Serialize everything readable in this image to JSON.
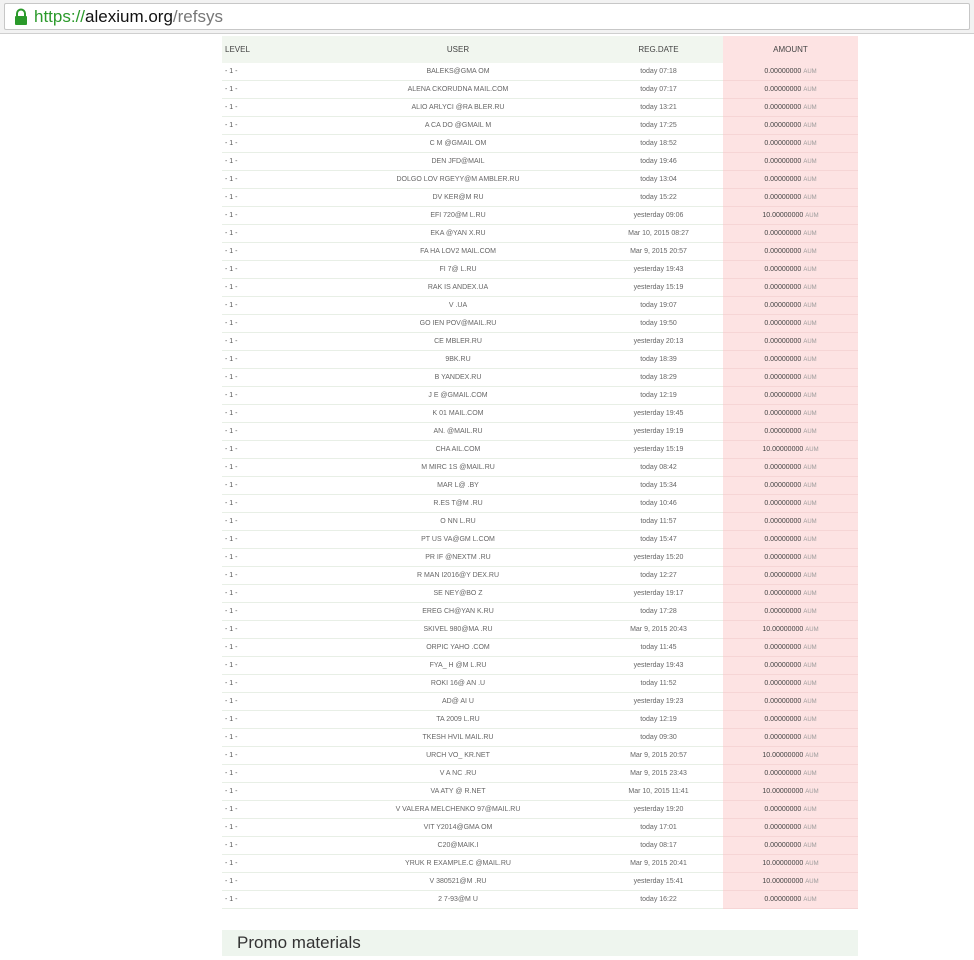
{
  "browser": {
    "url_scheme": "https://",
    "url_host": "alexium.org",
    "url_path": "/refsys"
  },
  "table": {
    "headers": {
      "level": "LEVEL",
      "user": "USER",
      "date": "REG.DATE",
      "amount": "AMOUNT"
    },
    "unit": "AUM",
    "rows": [
      {
        "level": "- 1 -",
        "user": "BALEKS@GMA    OM",
        "date": "today 07:18",
        "amount": "0.00000000"
      },
      {
        "level": "- 1 -",
        "user": "ALENA   CKORUDNA     MAIL.COM",
        "date": "today 07:17",
        "amount": "0.00000000"
      },
      {
        "level": "- 1 -",
        "user": "ALIO    ARLYCI    @RA    BLER.RU",
        "date": "today 13:21",
        "amount": "0.00000000"
      },
      {
        "level": "- 1 -",
        "user": "A     CA    DO    @GMAIL    M",
        "date": "today 17:25",
        "amount": "0.00000000"
      },
      {
        "level": "- 1 -",
        "user": "C    M     @GMAIL     OM",
        "date": "today 18:52",
        "amount": "0.00000000"
      },
      {
        "level": "- 1 -",
        "user": "DEN    JFD@MAIL",
        "date": "today 19:46",
        "amount": "0.00000000"
      },
      {
        "level": "- 1 -",
        "user": "DOLGO    LOV    RGEYY@M    AMBLER.RU",
        "date": "today 13:04",
        "amount": "0.00000000"
      },
      {
        "level": "- 1 -",
        "user": "DV    KER@M     RU",
        "date": "today 15:22",
        "amount": "0.00000000"
      },
      {
        "level": "- 1 -",
        "user": "EFI    720@M     L.RU",
        "date": "yesterday 09:06",
        "amount": "10.00000000"
      },
      {
        "level": "- 1 -",
        "user": "EKA    @YAN     X.RU",
        "date": "Mar 10, 2015 08:27",
        "amount": "0.00000000"
      },
      {
        "level": "- 1 -",
        "user": "FA    HA    LOV2    MAIL.COM",
        "date": "Mar 9, 2015 20:57",
        "amount": "0.00000000"
      },
      {
        "level": "- 1 -",
        "user": "FI     7@     L.RU",
        "date": "yesterday 19:43",
        "amount": "0.00000000"
      },
      {
        "level": "- 1 -",
        "user": "RAK    IS    ANDEX.UA",
        "date": "yesterday 15:19",
        "amount": "0.00000000"
      },
      {
        "level": "- 1 -",
        "user": "V     .UA",
        "date": "today 19:07",
        "amount": "0.00000000"
      },
      {
        "level": "- 1 -",
        "user": "GO    IEN    POV@MAIL.RU",
        "date": "today 19:50",
        "amount": "0.00000000"
      },
      {
        "level": "- 1 -",
        "user": "CE     MBLER.RU",
        "date": "yesterday 20:13",
        "amount": "0.00000000"
      },
      {
        "level": "- 1 -",
        "user": "9BK.RU",
        "date": "today 18:39",
        "amount": "0.00000000"
      },
      {
        "level": "- 1 -",
        "user": "B     YANDEX.RU",
        "date": "today 18:29",
        "amount": "0.00000000"
      },
      {
        "level": "- 1 -",
        "user": "J    E     @GMAIL.COM",
        "date": "today 12:19",
        "amount": "0.00000000"
      },
      {
        "level": "- 1 -",
        "user": "K    01     MAIL.COM",
        "date": "yesterday 19:45",
        "amount": "0.00000000"
      },
      {
        "level": "- 1 -",
        "user": "AN.     @MAIL.RU",
        "date": "yesterday 19:19",
        "amount": "0.00000000"
      },
      {
        "level": "- 1 -",
        "user": "CHA     AIL.COM",
        "date": "yesterday 15:19",
        "amount": "10.00000000"
      },
      {
        "level": "- 1 -",
        "user": "M    MIRC    1S    @MAIL.RU",
        "date": "today 08:42",
        "amount": "0.00000000"
      },
      {
        "level": "- 1 -",
        "user": "MAR    L@     .BY",
        "date": "today 15:34",
        "amount": "0.00000000"
      },
      {
        "level": "- 1 -",
        "user": "R.ES     T@M     .RU",
        "date": "today 10:46",
        "amount": "0.00000000"
      },
      {
        "level": "- 1 -",
        "user": "O    NN     L.RU",
        "date": "today 11:57",
        "amount": "0.00000000"
      },
      {
        "level": "- 1 -",
        "user": "PT    US    VA@GM     L.COM",
        "date": "today 15:47",
        "amount": "0.00000000"
      },
      {
        "level": "- 1 -",
        "user": "PR    IF    @NEXTM     .RU",
        "date": "yesterday 15:20",
        "amount": "0.00000000"
      },
      {
        "level": "- 1 -",
        "user": "R    MAN    I2016@Y    DEX.RU",
        "date": "today 12:27",
        "amount": "0.00000000"
      },
      {
        "level": "- 1 -",
        "user": "SE     NEY@BO     Z",
        "date": "yesterday 19:17",
        "amount": "0.00000000"
      },
      {
        "level": "- 1 -",
        "user": "EREG    CH@YAN     K.RU",
        "date": "today 17:28",
        "amount": "0.00000000"
      },
      {
        "level": "- 1 -",
        "user": "SKIVEL    980@MA     .RU",
        "date": "Mar 9, 2015 20:43",
        "amount": "10.00000000"
      },
      {
        "level": "- 1 -",
        "user": "ORPIC    YAHO     .COM",
        "date": "today 11:45",
        "amount": "0.00000000"
      },
      {
        "level": "- 1 -",
        "user": "FYA_    H    @M     L.RU",
        "date": "yesterday 19:43",
        "amount": "0.00000000"
      },
      {
        "level": "- 1 -",
        "user": "ROKI    16@     AN     .U",
        "date": "today 11:52",
        "amount": "0.00000000"
      },
      {
        "level": "- 1 -",
        "user": "AD@     AI     U",
        "date": "yesterday 19:23",
        "amount": "0.00000000"
      },
      {
        "level": "- 1 -",
        "user": "TA     2009     L.RU",
        "date": "today 12:19",
        "amount": "0.00000000"
      },
      {
        "level": "- 1 -",
        "user": "TKESH    HVIL     MAIL.RU",
        "date": "today 09:30",
        "amount": "0.00000000"
      },
      {
        "level": "- 1 -",
        "user": "URCH    VO_    KR.NET",
        "date": "Mar 9, 2015 20:57",
        "amount": "10.00000000"
      },
      {
        "level": "- 1 -",
        "user": "V     A     NC     .RU",
        "date": "Mar 9, 2015 23:43",
        "amount": "0.00000000"
      },
      {
        "level": "- 1 -",
        "user": "VA    ATY     @     R.NET",
        "date": "Mar 10, 2015 11:41",
        "amount": "10.00000000"
      },
      {
        "level": "- 1 -",
        "user": "V    VALERA    MELCHENKO    97@MAIL.RU",
        "date": "yesterday 19:20",
        "amount": "0.00000000"
      },
      {
        "level": "- 1 -",
        "user": "VIT    Y2014@GMA    OM",
        "date": "today 17:01",
        "amount": "0.00000000"
      },
      {
        "level": "- 1 -",
        "user": "C20@MAIK.I",
        "date": "today 08:17",
        "amount": "0.00000000"
      },
      {
        "level": "- 1 -",
        "user": "YRUK    R    EXAMPLE.C    @MAIL.RU",
        "date": "Mar 9, 2015 20:41",
        "amount": "10.00000000"
      },
      {
        "level": "- 1 -",
        "user": "V    380521@M     .RU",
        "date": "yesterday 15:41",
        "amount": "10.00000000"
      },
      {
        "level": "- 1 -",
        "user": "2    7-93@M     U",
        "date": "today 16:22",
        "amount": "0.00000000"
      }
    ]
  },
  "promo": {
    "title": "Promo materials"
  }
}
